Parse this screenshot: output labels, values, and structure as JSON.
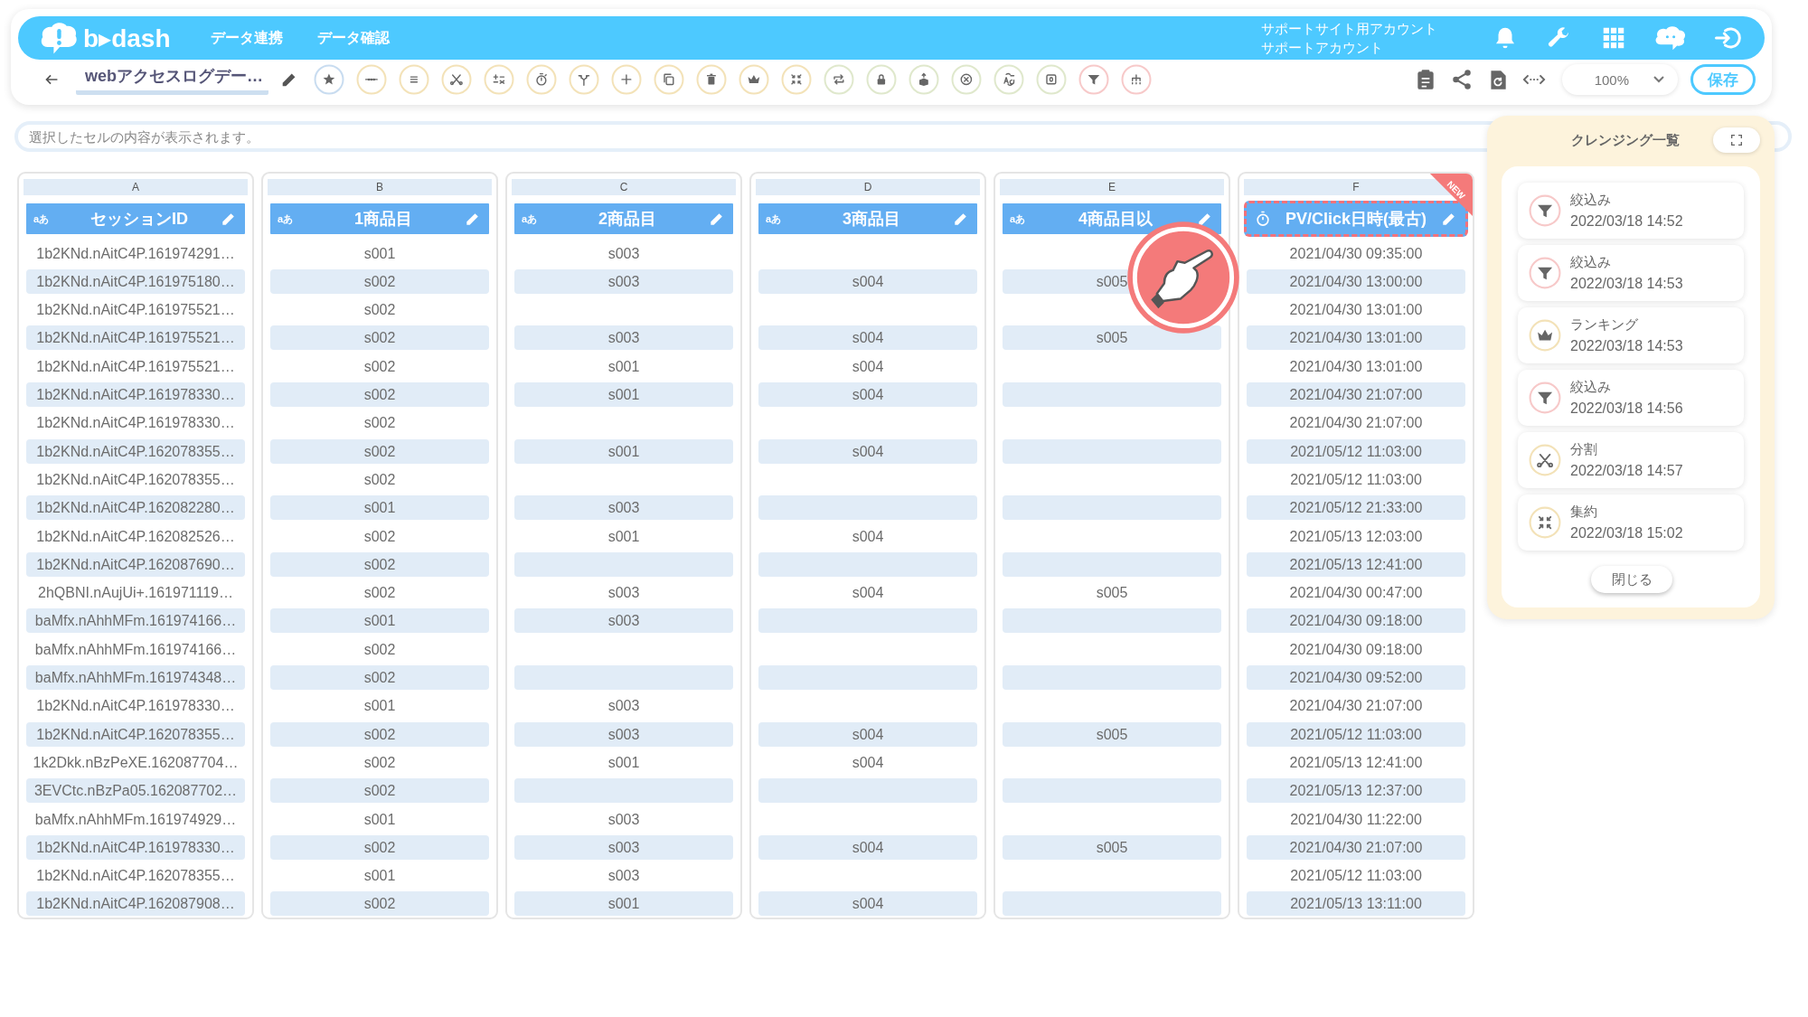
{
  "header": {
    "logo": "b▸dash",
    "nav": [
      "データ連携",
      "データ確認"
    ],
    "account": [
      "サポートサイト用アカウント",
      "サポートアカウント"
    ]
  },
  "toolbar": {
    "title": "webアクセスログデー…",
    "zoom": "100%",
    "save": "保存"
  },
  "cell_bar": {
    "placeholder": "選択したセルの内容が表示されます。"
  },
  "columns": [
    {
      "letter": "A",
      "kind": "text",
      "type_label": "aあ",
      "name": "セッションID",
      "highlighted": false
    },
    {
      "letter": "B",
      "kind": "text",
      "type_label": "aあ",
      "name": "1商品目",
      "highlighted": false
    },
    {
      "letter": "C",
      "kind": "text",
      "type_label": "aあ",
      "name": "2商品目",
      "highlighted": false
    },
    {
      "letter": "D",
      "kind": "text",
      "type_label": "aあ",
      "name": "3商品目",
      "highlighted": false
    },
    {
      "letter": "E",
      "kind": "text",
      "type_label": "aあ",
      "name": "4商品目以",
      "highlighted": false
    },
    {
      "letter": "F",
      "kind": "datetime",
      "name": "PV/Click日時(最古)",
      "badge": "NEW",
      "highlighted": true
    }
  ],
  "rows": [
    [
      "1b2KNd.nAitC4P.161974291…",
      "s001",
      "s003",
      null,
      null,
      "2021/04/30 09:35:00"
    ],
    [
      "1b2KNd.nAitC4P.161975180…",
      "s002",
      "s003",
      "s004",
      "s005",
      "2021/04/30 13:00:00"
    ],
    [
      "1b2KNd.nAitC4P.161975521…",
      "s002",
      null,
      null,
      null,
      "2021/04/30 13:01:00"
    ],
    [
      "1b2KNd.nAitC4P.161975521…",
      "s002",
      "s003",
      "s004",
      "s005",
      "2021/04/30 13:01:00"
    ],
    [
      "1b2KNd.nAitC4P.161975521…",
      "s002",
      "s001",
      "s004",
      null,
      "2021/04/30 13:01:00"
    ],
    [
      "1b2KNd.nAitC4P.161978330…",
      "s002",
      "s001",
      "s004",
      null,
      "2021/04/30 21:07:00"
    ],
    [
      "1b2KNd.nAitC4P.161978330…",
      "s002",
      null,
      null,
      null,
      "2021/04/30 21:07:00"
    ],
    [
      "1b2KNd.nAitC4P.162078355…",
      "s002",
      "s001",
      "s004",
      null,
      "2021/05/12 11:03:00"
    ],
    [
      "1b2KNd.nAitC4P.162078355…",
      "s002",
      null,
      null,
      null,
      "2021/05/12 11:03:00"
    ],
    [
      "1b2KNd.nAitC4P.162082280…",
      "s001",
      "s003",
      null,
      null,
      "2021/05/12 21:33:00"
    ],
    [
      "1b2KNd.nAitC4P.162082526…",
      "s002",
      "s001",
      "s004",
      null,
      "2021/05/13 12:03:00"
    ],
    [
      "1b2KNd.nAitC4P.162087690…",
      "s002",
      null,
      null,
      null,
      "2021/05/13 12:41:00"
    ],
    [
      "2hQBNI.nAujUi+.161971119…",
      "s002",
      "s003",
      "s004",
      "s005",
      "2021/04/30 00:47:00"
    ],
    [
      "baMfx.nAhhMFm.161974166…",
      "s001",
      "s003",
      null,
      null,
      "2021/04/30 09:18:00"
    ],
    [
      "baMfx.nAhhMFm.161974166…",
      "s002",
      null,
      null,
      null,
      "2021/04/30 09:18:00"
    ],
    [
      "baMfx.nAhhMFm.161974348…",
      "s002",
      null,
      null,
      null,
      "2021/04/30 09:52:00"
    ],
    [
      "1b2KNd.nAitC4P.161978330…",
      "s001",
      "s003",
      null,
      null,
      "2021/04/30 21:07:00"
    ],
    [
      "1b2KNd.nAitC4P.162078355…",
      "s002",
      "s003",
      "s004",
      "s005",
      "2021/05/12 11:03:00"
    ],
    [
      "1k2Dkk.nBzPeXE.162087704…",
      "s002",
      "s001",
      "s004",
      null,
      "2021/05/13 12:41:00"
    ],
    [
      "3EVCtc.nBzPa05.162087702…",
      "s002",
      null,
      null,
      null,
      "2021/05/13 12:37:00"
    ],
    [
      "baMfx.nAhhMFm.161974929…",
      "s001",
      "s003",
      null,
      null,
      "2021/04/30 11:22:00"
    ],
    [
      "1b2KNd.nAitC4P.161978330…",
      "s002",
      "s003",
      "s004",
      "s005",
      "2021/04/30 21:07:00"
    ],
    [
      "1b2KNd.nAitC4P.162078355…",
      "s001",
      "s003",
      null,
      null,
      "2021/05/12 11:03:00"
    ],
    [
      "1b2KNd.nAitC4P.162087908…",
      "s002",
      "s001",
      "s004",
      null,
      "2021/05/13 13:11:00"
    ]
  ],
  "cleansing_panel": {
    "title": "クレンジング一覧",
    "close": "閉じる",
    "items": [
      {
        "kind": "filter",
        "label": "絞込み",
        "time": "2022/03/18 14:52"
      },
      {
        "kind": "filter",
        "label": "絞込み",
        "time": "2022/03/18 14:53"
      },
      {
        "kind": "ranking",
        "label": "ランキング",
        "time": "2022/03/18 14:53"
      },
      {
        "kind": "filter",
        "label": "絞込み",
        "time": "2022/03/18 14:56"
      },
      {
        "kind": "split",
        "label": "分割",
        "time": "2022/03/18 14:57"
      },
      {
        "kind": "aggregate",
        "label": "集約",
        "time": "2022/03/18 15:02"
      }
    ]
  }
}
